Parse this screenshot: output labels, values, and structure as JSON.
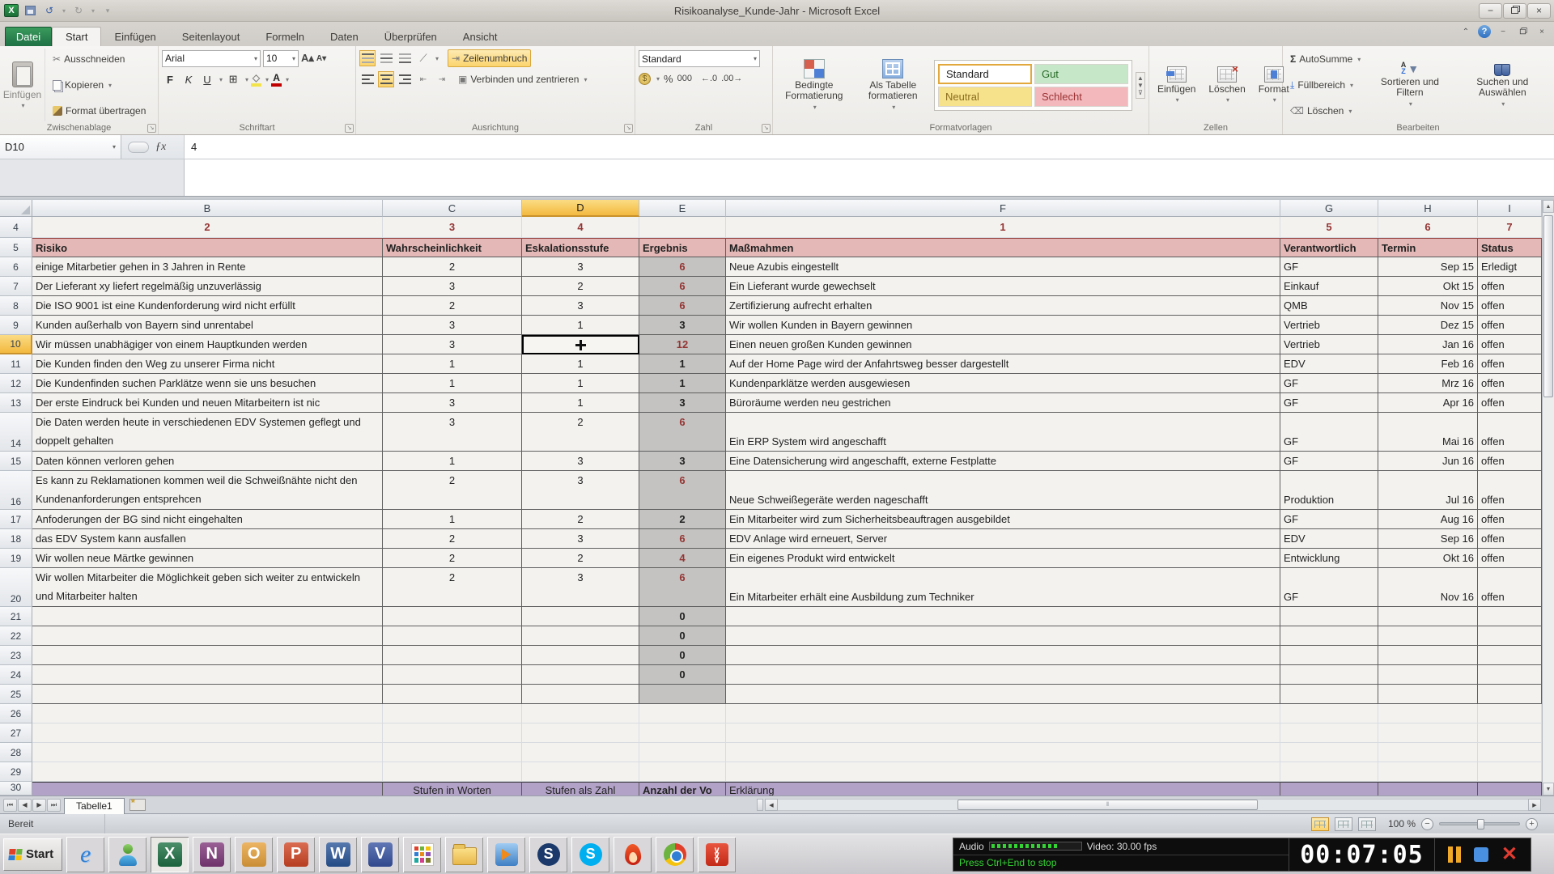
{
  "title_bar": {
    "title": "Risikoanalyse_Kunde-Jahr  -  Microsoft Excel"
  },
  "ribbon": {
    "file_tab": "Datei",
    "active_tab": "Start",
    "tabs": [
      "Start",
      "Einfügen",
      "Seitenlayout",
      "Formeln",
      "Daten",
      "Überprüfen",
      "Ansicht"
    ],
    "groups": {
      "clipboard": {
        "label": "Zwischenablage",
        "paste": "Einfügen",
        "cut": "Ausschneiden",
        "copy": "Kopieren",
        "format_painter": "Format übertragen"
      },
      "font": {
        "label": "Schriftart",
        "name": "Arial",
        "size": "10",
        "bold": "F",
        "italic": "K",
        "underline": "U",
        "fill_color": "#f3e34a",
        "font_color": "#c00000"
      },
      "alignment": {
        "label": "Ausrichtung",
        "wrap": "Zeilenumbruch",
        "merge": "Verbinden und zentrieren"
      },
      "number": {
        "label": "Zahl",
        "format": "Standard",
        "percent": "%",
        "thousands": "000",
        "inc_dec": "←.0",
        "dec_dec": ".00→"
      },
      "styles": {
        "label": "Formatvorlagen",
        "conditional": "Bedingte Formatierung",
        "as_table": "Als Tabelle formatieren",
        "gallery": [
          {
            "name": "Standard",
            "type": "standard"
          },
          {
            "name": "Gut",
            "type": "good"
          },
          {
            "name": "Neutral",
            "type": "neutral"
          },
          {
            "name": "Schlecht",
            "type": "bad"
          }
        ]
      },
      "cells": {
        "label": "Zellen",
        "insert": "Einfügen",
        "delete": "Löschen",
        "format": "Format"
      },
      "editing": {
        "label": "Bearbeiten",
        "autosum": "AutoSumme",
        "fill": "Füllbereich",
        "clear": "Löschen",
        "sort": "Sortieren und Filtern",
        "find": "Suchen und Auswählen"
      }
    }
  },
  "formula_bar": {
    "name_box": "D10",
    "value": "4"
  },
  "sheet": {
    "selected_column": "D",
    "selected_row": "10",
    "columns": [
      "B",
      "C",
      "D",
      "E",
      "F",
      "G",
      "H",
      "I"
    ],
    "row4": {
      "num": "4",
      "values": [
        "2",
        "3",
        "4",
        "",
        "1",
        "5",
        "6",
        "7"
      ]
    },
    "row5": {
      "num": "5",
      "headers": [
        "Risiko",
        "Wahrscheinlichkeit",
        "Eskalationsstufe",
        "Ergebnis",
        "Maßmahmen",
        "Verantwortlich",
        "Termin",
        "Status"
      ]
    },
    "rows": [
      {
        "num": "6",
        "risk": "einige Mitarbetier gehen in 3 Jahren in Rente",
        "prob": "2",
        "esc": "3",
        "result": "6",
        "red": true,
        "measure": "Neue Azubis eingestellt",
        "owner": "GF",
        "due": "Sep 15",
        "status": "Erledigt",
        "lines": 1
      },
      {
        "num": "7",
        "risk": "Der Lieferant xy liefert regelmäßig unzuverlässig",
        "prob": "3",
        "esc": "2",
        "result": "6",
        "red": true,
        "measure": "Ein Lieferant wurde gewechselt",
        "owner": "Einkauf",
        "due": "Okt 15",
        "status": "offen",
        "lines": 1
      },
      {
        "num": "8",
        "risk": "Die ISO 9001 ist eine Kundenforderung wird nicht erfüllt",
        "prob": "2",
        "esc": "3",
        "result": "6",
        "red": true,
        "measure": "Zertifizierung aufrecht erhalten",
        "owner": "QMB",
        "due": "Nov 15",
        "status": "offen",
        "lines": 1
      },
      {
        "num": "9",
        "risk": "Kunden außerhalb von Bayern sind unrentabel",
        "prob": "3",
        "esc": "1",
        "result": "3",
        "red": false,
        "measure": "Wir wollen Kunden in Bayern gewinnen",
        "owner": "Vertrieb",
        "due": "Dez 15",
        "status": "offen",
        "lines": 1
      },
      {
        "num": "10",
        "selected": true,
        "risk": "Wir müssen unabhägiger von einem Hauptkunden werden",
        "prob": "3",
        "esc": "",
        "result": "12",
        "red": true,
        "measure": "Einen neuen großen Kunden gewinnen",
        "owner": "Vertrieb",
        "due": "Jan 16",
        "status": "offen",
        "lines": 1
      },
      {
        "num": "11",
        "risk": "Die Kunden finden den Weg zu unserer Firma nicht",
        "prob": "1",
        "esc": "1",
        "result": "1",
        "red": false,
        "measure": "Auf der Home Page wird der Anfahrtsweg besser dargestellt",
        "owner": "EDV",
        "due": "Feb 16",
        "status": "offen",
        "lines": 1
      },
      {
        "num": "12",
        "risk": "Die Kundenfinden suchen Parklätze wenn sie uns besuchen",
        "prob": "1",
        "esc": "1",
        "result": "1",
        "red": false,
        "measure": "Kundenparklätze werden ausgewiesen",
        "owner": "GF",
        "due": "Mrz 16",
        "status": "offen",
        "lines": 1
      },
      {
        "num": "13",
        "risk": "Der erste Eindruck bei Kunden und neuen Mitarbeitern ist nic",
        "prob": "3",
        "esc": "1",
        "result": "3",
        "red": false,
        "measure": "Büroräume werden neu gestrichen",
        "owner": "GF",
        "due": "Apr 16",
        "status": "offen",
        "lines": 1
      },
      {
        "num": "14",
        "risk": "Die Daten werden heute in verschiedenen EDV Systemen geflegt und doppelt gehalten",
        "prob": "3",
        "esc": "2",
        "result": "6",
        "red": true,
        "measure": "Ein ERP System wird angeschafft",
        "owner": "GF",
        "due": "Mai 16",
        "status": "offen",
        "lines": 2
      },
      {
        "num": "15",
        "risk": "Daten können verloren gehen",
        "prob": "1",
        "esc": "3",
        "result": "3",
        "red": false,
        "measure": "Eine Datensicherung wird angeschafft, externe Festplatte",
        "owner": "GF",
        "due": "Jun 16",
        "status": "offen",
        "lines": 1
      },
      {
        "num": "16",
        "risk": "Es kann zu Reklamationen kommen weil die Schweißnähte nicht den Kundenanforderungen entsprehcen",
        "prob": "2",
        "esc": "3",
        "result": "6",
        "red": true,
        "measure": "Neue Schweißegeräte werden nageschafft",
        "owner": "Produktion",
        "due": "Jul 16",
        "status": "offen",
        "lines": 2
      },
      {
        "num": "17",
        "risk": "Anfoderungen der BG sind nicht eingehalten",
        "prob": "1",
        "esc": "2",
        "result": "2",
        "red": false,
        "measure": "Ein Mitarbeiter wird zum Sicherheitsbeauftragen ausgebildet",
        "owner": "GF",
        "due": "Aug 16",
        "status": "offen",
        "lines": 1
      },
      {
        "num": "18",
        "risk": "das EDV System kann ausfallen",
        "prob": "2",
        "esc": "3",
        "result": "6",
        "red": true,
        "measure": "EDV Anlage wird erneuert, Server",
        "owner": "EDV",
        "due": "Sep 16",
        "status": "offen",
        "lines": 1
      },
      {
        "num": "19",
        "risk": "Wir wollen neue Märtke gewinnen",
        "prob": "2",
        "esc": "2",
        "result": "4",
        "red": true,
        "measure": "Ein eigenes Produkt wird entwickelt",
        "owner": "Entwicklung",
        "due": "Okt 16",
        "status": "offen",
        "lines": 1
      },
      {
        "num": "20",
        "risk": "Wir wollen Mitarbeiter die Möglichkeit geben sich weiter zu entwickeln und Mitarbeiter halten",
        "prob": "2",
        "esc": "3",
        "result": "6",
        "red": true,
        "measure": "Ein Mitarbeiter erhält eine Ausbildung zum Techniker",
        "owner": "GF",
        "due": "Nov 16",
        "status": "offen",
        "lines": 2
      },
      {
        "num": "21",
        "risk": "",
        "prob": "",
        "esc": "",
        "result": "0",
        "red": false,
        "measure": "",
        "owner": "",
        "due": "",
        "status": "",
        "lines": 1
      },
      {
        "num": "22",
        "risk": "",
        "prob": "",
        "esc": "",
        "result": "0",
        "red": false,
        "measure": "",
        "owner": "",
        "due": "",
        "status": "",
        "lines": 1
      },
      {
        "num": "23",
        "risk": "",
        "prob": "",
        "esc": "",
        "result": "0",
        "red": false,
        "measure": "",
        "owner": "",
        "due": "",
        "status": "",
        "lines": 1
      },
      {
        "num": "24",
        "risk": "",
        "prob": "",
        "esc": "",
        "result": "0",
        "red": false,
        "measure": "",
        "owner": "",
        "due": "",
        "status": "",
        "lines": 1
      },
      {
        "num": "25",
        "risk": "",
        "prob": "",
        "esc": "",
        "result": "",
        "red": false,
        "measure": "",
        "owner": "",
        "due": "",
        "status": "",
        "lines": 1
      }
    ],
    "empty_row_nums": [
      "26",
      "27",
      "28",
      "29"
    ],
    "row30": {
      "num": "30",
      "stufen_worte": "Stufen in Worten",
      "stufen_zahl": "Stufen als Zahl",
      "anzahl": "Anzahl der Vo",
      "erklaerung": "Erklärung"
    },
    "colors": {
      "accent_red": "#943634",
      "header_pink": "#e3b8b6",
      "result_gray": "#c4c3c1",
      "row30_purple": "#b2a2c7",
      "selection_amber": "#f3b93f"
    }
  },
  "sheet_tabs": {
    "active": "Tabelle1"
  },
  "status_bar": {
    "mode": "Bereit",
    "zoom": "100 %"
  },
  "taskbar": {
    "start": "Start",
    "icons": [
      {
        "name": "internet-explorer-icon",
        "kind": "ie",
        "glyph": "e"
      },
      {
        "name": "messenger-icon",
        "kind": "msn",
        "glyph": ""
      },
      {
        "name": "excel-icon",
        "kind": "letter",
        "glyph": "X",
        "bg": "#1e7145",
        "active": true
      },
      {
        "name": "onenote-icon",
        "kind": "letter",
        "glyph": "N",
        "bg": "#80397b"
      },
      {
        "name": "outlook-icon",
        "kind": "letter",
        "glyph": "O",
        "bg": "#e8a33d"
      },
      {
        "name": "powerpoint-icon",
        "kind": "letter",
        "glyph": "P",
        "bg": "#d24726"
      },
      {
        "name": "word-icon",
        "kind": "letter",
        "glyph": "W",
        "bg": "#2b579a"
      },
      {
        "name": "visio-icon",
        "kind": "letter",
        "glyph": "V",
        "bg": "#3955a3"
      },
      {
        "name": "office-launcher-icon",
        "kind": "grid",
        "glyph": ""
      },
      {
        "name": "folder-icon",
        "kind": "folder",
        "glyph": ""
      },
      {
        "name": "media-player-icon",
        "kind": "player",
        "glyph": ""
      },
      {
        "name": "app-s-icon",
        "kind": "circle",
        "glyph": "S",
        "bg": "#1b3a6b"
      },
      {
        "name": "skype-icon",
        "kind": "circle",
        "glyph": "S",
        "bg": "#00aff0"
      },
      {
        "name": "flame-icon",
        "kind": "flame",
        "glyph": ""
      },
      {
        "name": "chrome-icon",
        "kind": "chrome",
        "glyph": ""
      },
      {
        "name": "red-app-icon",
        "kind": "chevrons",
        "glyph": "∨"
      }
    ]
  },
  "recorder": {
    "audio_label": "Audio",
    "video_label": "Video: 30.00 fps",
    "hint": "Press Ctrl+End to stop",
    "time": "00:07:05"
  }
}
